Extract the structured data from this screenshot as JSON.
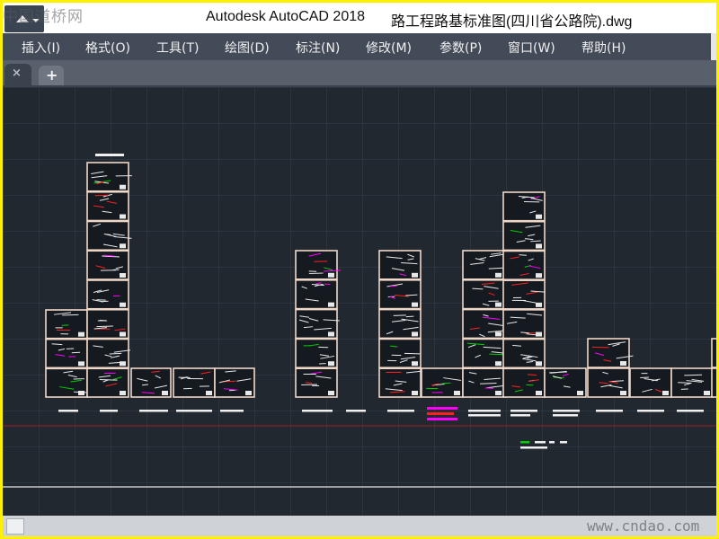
{
  "window": {
    "app_name": "Autodesk AutoCAD 2018",
    "file_name": "路工程路基标准图(四川省公路院).dwg",
    "watermark_top": "中国道桥网",
    "watermark_bottom": "www.cndao.com"
  },
  "menu": {
    "items": [
      {
        "label": "插入(I)"
      },
      {
        "label": "格式(O)"
      },
      {
        "label": "工具(T)"
      },
      {
        "label": "绘图(D)"
      },
      {
        "label": "标注(N)"
      },
      {
        "label": "修改(M)"
      },
      {
        "label": "参数(P)"
      },
      {
        "label": "窗口(W)"
      },
      {
        "label": "帮助(H)"
      }
    ]
  },
  "tabs": {
    "close_glyph": "×",
    "add_glyph": "+"
  },
  "colors": {
    "frame": "#fff200",
    "canvas": "#212830",
    "menu_bg": "#434b58",
    "sheet_border": "#f0d8c8",
    "accent_red": "#ff2020",
    "accent_magenta": "#ff00ff",
    "accent_green": "#00d000"
  },
  "icons": {
    "app_menu": "autocad-a-icon",
    "tab_close": "close-icon",
    "tab_add": "plus-icon"
  }
}
